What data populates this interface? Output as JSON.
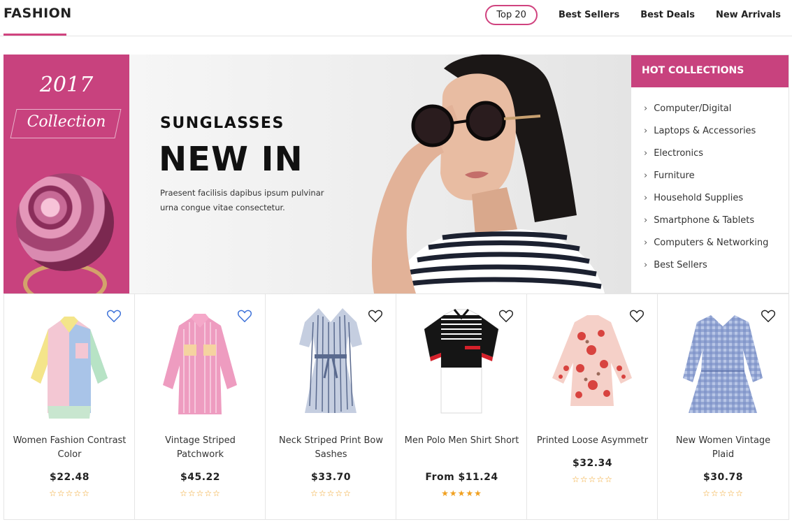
{
  "header": {
    "brand": "FASHION",
    "tabs": [
      {
        "label": "Top 20",
        "active": true
      },
      {
        "label": "Best Sellers",
        "active": false
      },
      {
        "label": "Best Deals",
        "active": false
      },
      {
        "label": "New Arrivals",
        "active": false
      }
    ]
  },
  "promo": {
    "year": "2017",
    "collection": "Collection"
  },
  "hero": {
    "subtitle": "SUNGLASSES",
    "title": "NEW IN",
    "description": "Praesent facilisis dapibus ipsum pulvinar urna congue vitae consectetur."
  },
  "hot_collections": {
    "title": "HOT COLLECTIONS",
    "items": [
      "Computer/Digital",
      "Laptops & Accessories",
      "Electronics",
      "Furniture",
      "Household Supplies",
      "Smartphone & Tablets",
      "Computers & Networking",
      "Best Sellers"
    ]
  },
  "products": [
    {
      "name": "Women Fashion Contrast Color",
      "price": "$22.48",
      "rating": 0,
      "wishlist_color": "#3a6fd8"
    },
    {
      "name": "Vintage Striped Patchwork",
      "price": "$45.22",
      "rating": 0,
      "wishlist_color": "#3a6fd8"
    },
    {
      "name": "Neck Striped Print Bow Sashes",
      "price": "$33.70",
      "rating": 0,
      "wishlist_color": "#222222"
    },
    {
      "name": "Men Polo Men Shirt Short",
      "price": "From $11.24",
      "rating": 5,
      "wishlist_color": "#222222"
    },
    {
      "name": "Printed Loose Asymmetr",
      "price": "$32.34",
      "rating": 0,
      "wishlist_color": "#222222"
    },
    {
      "name": "New Women Vintage Plaid",
      "price": "$30.78",
      "rating": 0,
      "wishlist_color": "#222222"
    }
  ],
  "colors": {
    "accent": "#c8427e",
    "star": "#f0a020"
  }
}
